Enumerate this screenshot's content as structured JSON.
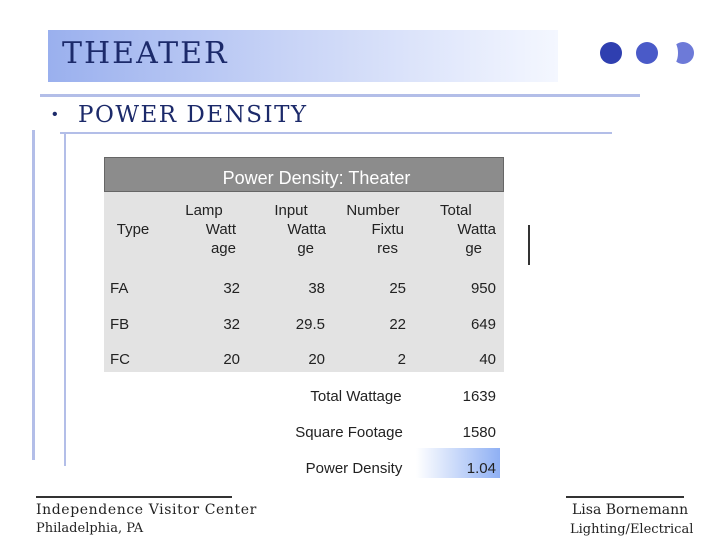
{
  "slide": {
    "title": "THEATER",
    "subtitle": "POWER DENSITY",
    "bullet": "•",
    "colors": {
      "title_text": "#1c2a6a",
      "banner_start": "#9ab0ee",
      "accent_dots": [
        "#2f3fb0",
        "#4a5ac8",
        "#6d7ad8"
      ],
      "table_header": "#8c8c8c",
      "highlight": "#8fb0f4"
    }
  },
  "table": {
    "title": "Power Density:  Theater",
    "columns": [
      {
        "label_lines": [
          "Type"
        ]
      },
      {
        "label_lines": [
          "Lamp",
          "Watt",
          "age"
        ]
      },
      {
        "label_lines": [
          "Input",
          "Watta",
          "ge"
        ]
      },
      {
        "label_lines": [
          "Number",
          "Fixtu",
          "res"
        ]
      },
      {
        "label_lines": [
          "Total",
          "Watta",
          "ge"
        ]
      }
    ],
    "rows": [
      {
        "type": "FA",
        "lamp_wattage": "32",
        "input_wattage": "38",
        "fixtures": "25",
        "total_wattage": "950"
      },
      {
        "type": "FB",
        "lamp_wattage": "32",
        "input_wattage": "29.5",
        "fixtures": "22",
        "total_wattage": "649"
      },
      {
        "type": "FC",
        "lamp_wattage": "20",
        "input_wattage": "20",
        "fixtures": "2",
        "total_wattage": "40"
      }
    ],
    "summary": [
      {
        "label": "Total Wattage",
        "value": "1639"
      },
      {
        "label": "Square Footage",
        "value": "1580"
      },
      {
        "label": "Power Density",
        "value": "1.04"
      }
    ]
  },
  "footer": {
    "left_line1": "Independence Visitor Center",
    "left_line2": "Philadelphia, PA",
    "right_line1": "Lisa Bornemann",
    "right_line2": "Lighting/Electrical"
  }
}
